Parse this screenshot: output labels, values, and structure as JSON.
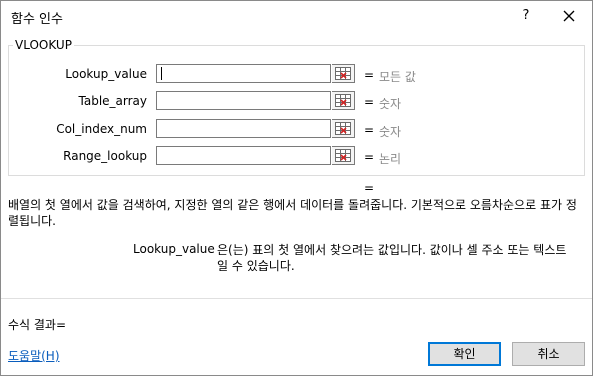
{
  "window": {
    "title": "함수 인수",
    "help": "?",
    "close": "close"
  },
  "function": {
    "name": "VLOOKUP"
  },
  "args": [
    {
      "label": "Lookup_value",
      "value": "",
      "eq": "=",
      "result": "모든 값"
    },
    {
      "label": "Table_array",
      "value": "",
      "eq": "=",
      "result": "숫자"
    },
    {
      "label": "Col_index_num",
      "value": "",
      "eq": "=",
      "result": "숫자"
    },
    {
      "label": "Range_lookup",
      "value": "",
      "eq": "=",
      "result": "논리"
    }
  ],
  "result_eq": "=",
  "description": "배열의 첫 열에서 값을 검색하여, 지정한 열의 같은 행에서 데이터를 돌려줍니다. 기본적으로 오름차순으로 표가 정렬됩니다.",
  "arg_help": {
    "name": "Lookup_value",
    "text": "은(는) 표의 첫 열에서 찾으려는 값입니다. 값이나 셀 주소 또는 텍스트일 수 있습니다."
  },
  "formula_result": "수식 결과=",
  "help_link": "도움말(H)",
  "buttons": {
    "ok": "확인",
    "cancel": "취소"
  },
  "colors": {
    "accent": "#0078d7",
    "link": "#0a5dbd",
    "hint": "#8a8a8a"
  }
}
